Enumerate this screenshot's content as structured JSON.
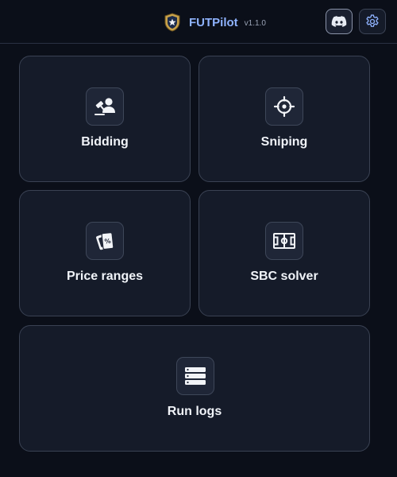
{
  "header": {
    "app_name": "FUTPilot",
    "version": "v1.1.0",
    "logo_icon": "shield-star-logo",
    "discord_icon": "discord-icon",
    "settings_icon": "gear-icon"
  },
  "tiles": [
    {
      "label": "Bidding",
      "icon": "gavel-person-icon"
    },
    {
      "label": "Sniping",
      "icon": "crosshair-icon"
    },
    {
      "label": "Price ranges",
      "icon": "price-tags-icon"
    },
    {
      "label": "SBC solver",
      "icon": "football-pitch-icon"
    },
    {
      "label": "Run logs",
      "icon": "server-list-icon"
    }
  ],
  "colors": {
    "background": "#0b0f19",
    "card": "#151b29",
    "accent": "#8fb3ff"
  }
}
